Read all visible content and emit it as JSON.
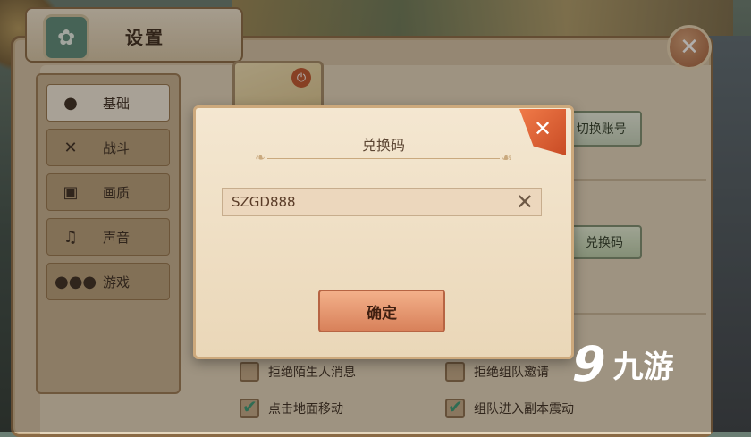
{
  "settings": {
    "title": "设置",
    "sidebar": [
      {
        "label": "基础",
        "icon": "bulb-icon"
      },
      {
        "label": "战斗",
        "icon": "crossed-swords-icon"
      },
      {
        "label": "画质",
        "icon": "picture-icon"
      },
      {
        "label": "声音",
        "icon": "music-note-icon"
      },
      {
        "label": "游戏",
        "icon": "chat-bubble-icon"
      }
    ],
    "switch_account_label": "切换账号",
    "redeem_button_label": "兑换码",
    "options": [
      {
        "label": "拒绝陌生人消息",
        "checked": false
      },
      {
        "label": "拒绝组队邀请",
        "checked": false
      },
      {
        "label": "点击地面移动",
        "checked": true
      },
      {
        "label": "组队进入副本震动",
        "checked": true
      }
    ]
  },
  "dialog": {
    "title": "兑换码",
    "code_value": "SZGD888",
    "confirm_label": "确定"
  },
  "watermark": {
    "text": "九游"
  },
  "colors": {
    "panel": "#d6c4a8",
    "accent_orange": "#d8815a",
    "check_green": "#3a9a77"
  }
}
